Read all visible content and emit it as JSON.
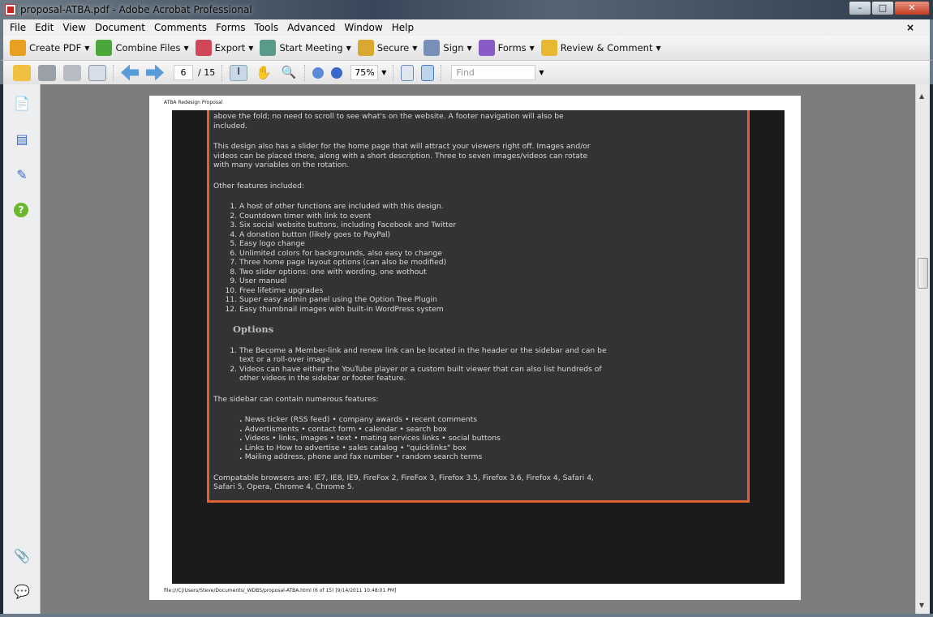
{
  "window": {
    "title": "proposal-ATBA.pdf - Adobe Acrobat Professional",
    "min": "–",
    "max": "□",
    "close": "✕"
  },
  "menu": [
    "File",
    "Edit",
    "View",
    "Document",
    "Comments",
    "Forms",
    "Tools",
    "Advanced",
    "Window",
    "Help"
  ],
  "menu_close": "×",
  "toolbar1": [
    {
      "label": "Create PDF",
      "icon": "create-pdf-icon",
      "color": "#e8a020"
    },
    {
      "label": "Combine Files",
      "icon": "combine-files-icon",
      "color": "#4aa83a"
    },
    {
      "label": "Export",
      "icon": "export-icon",
      "color": "#d04858"
    },
    {
      "label": "Start Meeting",
      "icon": "meeting-icon",
      "color": "#5a9a8a"
    },
    {
      "label": "Secure",
      "icon": "lock-icon",
      "color": "#d8a830"
    },
    {
      "label": "Sign",
      "icon": "pen-icon",
      "color": "#7890b8"
    },
    {
      "label": "Forms",
      "icon": "forms-icon",
      "color": "#8a5ac8"
    },
    {
      "label": "Review & Comment",
      "icon": "comment-icon",
      "color": "#e8b830"
    }
  ],
  "toolbar2": {
    "page": "6",
    "total": "/ 15",
    "zoom": "75%",
    "find_placeholder": "Find"
  },
  "document": {
    "header": "ATBA Redesign Proposal",
    "footer": "file:///C|/Users/Steve/Documents/_WDBS/proposal-ATBA.html (6 of 15) [9/14/2011 10:48:01 PM]",
    "p1": "above the fold; no need to scroll to see what's on the website. A footer navigation will also be included.",
    "p2": "This design also has a slider for the home page that will attract your viewers right off. Images and/or videos can be placed there, along with a short description. Three to seven images/videos can rotate with many variables on the rotation.",
    "p3": "Other features included:",
    "features": [
      "A host of other functions are included with this design.",
      "Countdown timer with link to event",
      "Six social website buttons, including Facebook and Twitter",
      "A donation button (likely goes to PayPal)",
      "Easy logo change",
      "Unlimited colors for backgrounds, also easy to change",
      "Three home page layout options (can also be modified)",
      "Two slider options: one with wording, one wothout",
      "User manuel",
      "Free lifetime upgrades",
      "Super easy admin panel using the Option Tree Plugin",
      "Easy thumbnail images with built-in WordPress system"
    ],
    "options_heading": "Options",
    "options": [
      "The Become a Member-link and renew link can be located in the header or the sidebar and can be text or a roll-over image.",
      "Videos can have either the YouTube player or a custom built viewer that can also list hundreds of other videos in the sidebar or footer feature."
    ],
    "p4": "The sidebar can contain numerous features:",
    "sidebar": [
      "News ticker (RSS feed) • company awards • recent comments",
      "Advertisments • contact form • calendar • search box",
      "Videos • links, images • text • mating services links • social buttons",
      "Links to How to advertise • sales catalog • \"quicklinks\" box",
      "Mailing address, phone and fax number • random search terms"
    ],
    "p5": "Compatable browsers are: IE7, IE8, IE9, FireFox 2, FireFox 3, Firefox 3.5, Firefox 3.6, Firefox 4, Safari 4, Safari 5, Opera, Chrome 4, Chrome 5."
  }
}
